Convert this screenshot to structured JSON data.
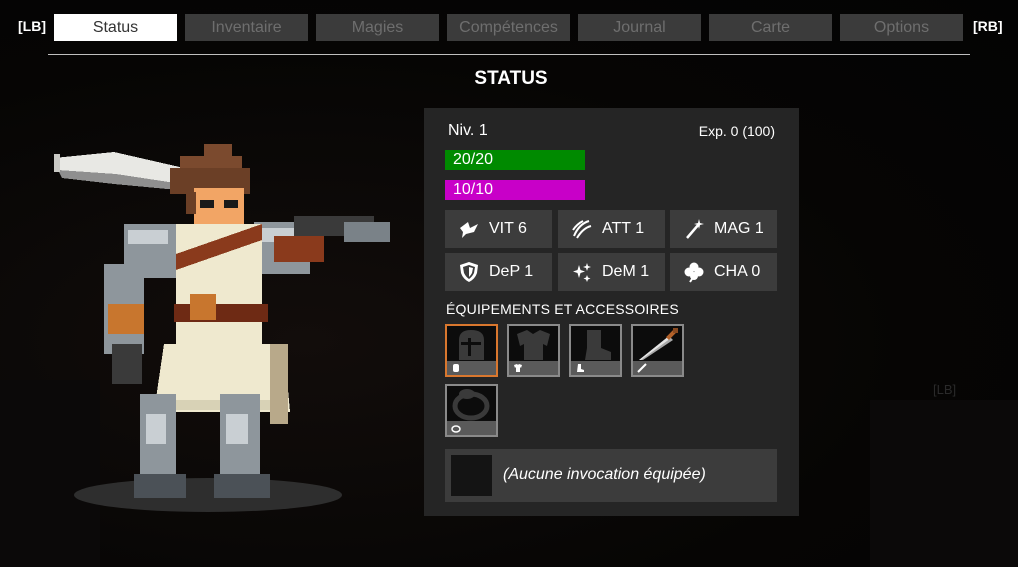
{
  "nav": {
    "left_bumper": "[LB]",
    "right_bumper": "[RB]",
    "tabs": [
      {
        "label": "Status",
        "active": true
      },
      {
        "label": "Inventaire",
        "active": false
      },
      {
        "label": "Magies",
        "active": false
      },
      {
        "label": "Compétences",
        "active": false
      },
      {
        "label": "Journal",
        "active": false
      },
      {
        "label": "Carte",
        "active": false
      },
      {
        "label": "Options",
        "active": false
      }
    ]
  },
  "page_title": "STATUS",
  "status": {
    "level": "Niv. 1",
    "exp": "Exp. 0 (100)",
    "hp": "20/20",
    "mp": "10/10",
    "stats": [
      {
        "icon": "dove-icon",
        "label": "VIT 6"
      },
      {
        "icon": "claw-slash-icon",
        "label": "ATT 1"
      },
      {
        "icon": "wand-icon",
        "label": "MAG 1"
      },
      {
        "icon": "shield-icon",
        "label": "DeP 1"
      },
      {
        "icon": "sparkles-icon",
        "label": "DeM 1"
      },
      {
        "icon": "clover-icon",
        "label": "CHA 0"
      }
    ],
    "equipment_heading": "ÉQUIPEMENTS ET ACCESSOIRES",
    "equipment_slots": [
      {
        "icon": "helmet-icon",
        "selected": true
      },
      {
        "icon": "armor-icon",
        "selected": false
      },
      {
        "icon": "boot-icon",
        "selected": false
      },
      {
        "icon": "dagger-icon",
        "selected": false
      },
      {
        "icon": "ring-icon",
        "selected": false
      }
    ],
    "summon_text": "(Aucune invocation équipée)"
  },
  "colors": {
    "hp_bar": "#008a00",
    "mp_bar": "#c800c8",
    "panel": "#252525",
    "selected_slot": "#d9772e",
    "active_tab": "#ffffff",
    "inactive_tab": "#3b3b3b"
  },
  "background_hud": {
    "lb_hint": "[LB]"
  }
}
